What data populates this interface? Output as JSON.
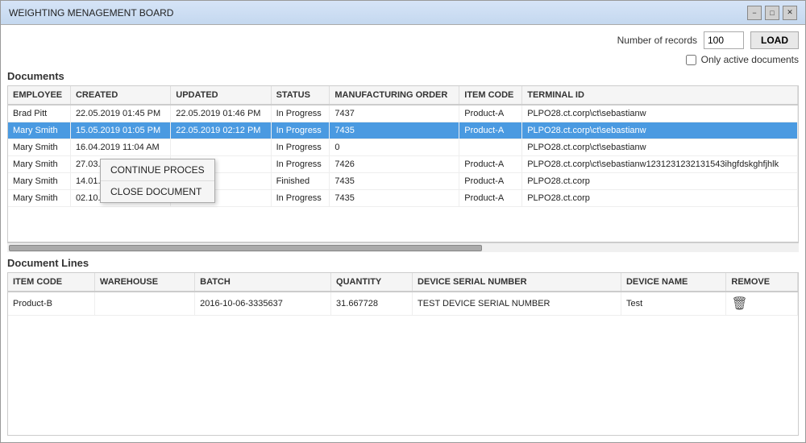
{
  "window": {
    "title": "WEIGHTING MENAGEMENT BOARD",
    "controls": {
      "minimize": "−",
      "maximize": "□",
      "close": "✕"
    }
  },
  "top_controls": {
    "records_label": "Number of records",
    "records_value": "100",
    "load_button": "LOAD",
    "active_docs_label": "Only active documents"
  },
  "documents_section": {
    "label": "Documents",
    "columns": [
      "EMPLOYEE",
      "CREATED",
      "UPDATED",
      "STATUS",
      "MANUFACTURING ORDER",
      "ITEM CODE",
      "TERMINAL ID"
    ],
    "rows": [
      {
        "employee": "Brad Pitt",
        "created": "22.05.2019 01:45 PM",
        "updated": "22.05.2019 01:46 PM",
        "status": "In Progress",
        "mfg_order": "7437",
        "item_code": "Product-A",
        "terminal_id": "PLPO28.ct.corp\\ct\\sebastianw",
        "selected": false
      },
      {
        "employee": "Mary Smith",
        "created": "15.05.2019 01:05 PM",
        "updated": "22.05.2019 02:12 PM",
        "status": "In Progress",
        "mfg_order": "7435",
        "item_code": "Product-A",
        "terminal_id": "PLPO28.ct.corp\\ct\\sebastianw",
        "selected": true
      },
      {
        "employee": "Mary Smith",
        "created": "16.04.2019 11:04 AM",
        "updated": "",
        "status": "In Progress",
        "mfg_order": "0",
        "item_code": "",
        "terminal_id": "PLPO28.ct.corp\\ct\\sebastianw",
        "selected": false
      },
      {
        "employee": "Mary Smith",
        "created": "27.03...",
        "updated": "",
        "status": "In Progress",
        "mfg_order": "7426",
        "item_code": "Product-A",
        "terminal_id": "PLPO28.ct.corp\\ct\\sebastianw1231231232131543ihgfdskghfjhlk",
        "selected": false
      },
      {
        "employee": "Mary Smith",
        "created": "14.01...",
        "updated": "",
        "status": "Finished",
        "mfg_order": "7435",
        "item_code": "Product-A",
        "terminal_id": "PLPO28.ct.corp",
        "selected": false
      },
      {
        "employee": "Mary Smith",
        "created": "02.10...",
        "updated": "",
        "status": "In Progress",
        "mfg_order": "7435",
        "item_code": "Product-A",
        "terminal_id": "PLPO28.ct.corp",
        "selected": false
      }
    ]
  },
  "context_menu": {
    "items": [
      "CONTINUE PROCES",
      "CLOSE DOCUMENT"
    ]
  },
  "doc_lines_section": {
    "label": "Document Lines",
    "columns": [
      "ITEM CODE",
      "WAREHOUSE",
      "BATCH",
      "QUANTITY",
      "DEVICE SERIAL NUMBER",
      "DEVICE NAME",
      "REMOVE"
    ],
    "rows": [
      {
        "item_code": "Product-B",
        "warehouse": "",
        "batch": "2016-10-06-3335637",
        "quantity": "31.667728",
        "device_serial": "TEST DEVICE SERIAL NUMBER",
        "device_name": "Test",
        "remove": "🗑"
      }
    ]
  }
}
